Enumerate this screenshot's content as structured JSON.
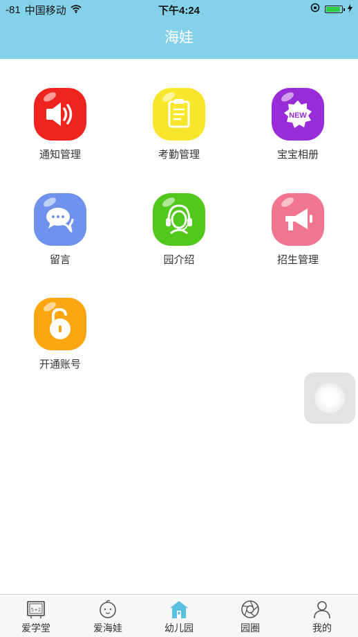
{
  "status_bar": {
    "signal": "-81",
    "carrier": "中国移动",
    "time": "下午4:24"
  },
  "header": {
    "title": "海娃"
  },
  "grid": [
    {
      "label": "通知管理",
      "icon": "speaker-icon",
      "color": "#f0241e"
    },
    {
      "label": "考勤管理",
      "icon": "clipboard-icon",
      "color": "#f7e62b"
    },
    {
      "label": "宝宝相册",
      "icon": "new-badge-icon",
      "color": "#9a2bd9"
    },
    {
      "label": "留言",
      "icon": "chat-bubbles-icon",
      "color": "#6f92ec"
    },
    {
      "label": "园介绍",
      "icon": "headset-person-icon",
      "color": "#52c81c"
    },
    {
      "label": "招生管理",
      "icon": "megaphone-icon",
      "color": "#f27590"
    },
    {
      "label": "开通账号",
      "icon": "unlock-icon",
      "color": "#fca712"
    }
  ],
  "tabbar": {
    "items": [
      {
        "label": "爱学堂",
        "icon": "blackboard-icon",
        "active": false
      },
      {
        "label": "爱海娃",
        "icon": "baby-face-icon",
        "active": false
      },
      {
        "label": "幼儿园",
        "icon": "school-house-icon",
        "active": true
      },
      {
        "label": "园圈",
        "icon": "aperture-icon",
        "active": false
      },
      {
        "label": "我的",
        "icon": "person-icon",
        "active": false
      }
    ]
  },
  "colors": {
    "header_bg": "#84d2e9",
    "active_tab": "#5bbfe0"
  }
}
